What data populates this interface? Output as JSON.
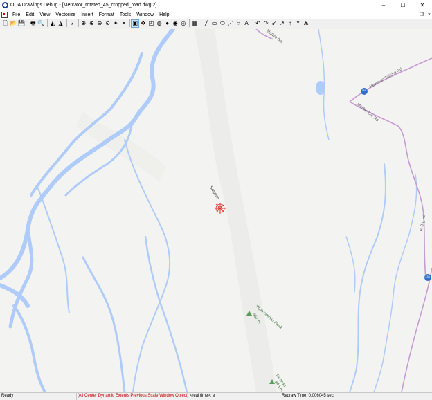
{
  "window": {
    "title": "ODA Drawings Debug - [Mercator_rotated_45_cropped_road.dwg:2]",
    "minimize": "–",
    "maximize": "☐",
    "close": "✕"
  },
  "mdi": {
    "minimize": "_",
    "restore": "❐",
    "close": "×"
  },
  "menu": [
    "File",
    "Edit",
    "View",
    "Vectorize",
    "Insert",
    "Format",
    "Tools",
    "Window",
    "Help"
  ],
  "toolbar": [
    {
      "name": "new-icon",
      "glyph": "🗋"
    },
    {
      "name": "open-icon",
      "glyph": "📂"
    },
    {
      "name": "save-icon",
      "glyph": "💾"
    },
    {
      "sep": true
    },
    {
      "name": "print-icon",
      "glyph": "🖶"
    },
    {
      "name": "print-preview-icon",
      "glyph": "🔍"
    },
    {
      "sep": true
    },
    {
      "name": "undo-draw-icon",
      "glyph": "◭"
    },
    {
      "name": "redo-draw-icon",
      "glyph": "◮"
    },
    {
      "sep": true
    },
    {
      "name": "help-icon",
      "glyph": "?"
    },
    {
      "sep": true
    },
    {
      "name": "zoom-window-icon",
      "glyph": "⊕"
    },
    {
      "name": "zoom-in-icon",
      "glyph": "⊕"
    },
    {
      "name": "zoom-out-icon",
      "glyph": "⊖"
    },
    {
      "name": "zoom-extents-icon",
      "glyph": "⊙"
    },
    {
      "name": "zoom-realtime-icon",
      "glyph": "✦"
    },
    {
      "name": "orbit-icon",
      "glyph": "◓"
    },
    {
      "sep": true
    },
    {
      "name": "select-icon",
      "glyph": "▣",
      "active": true
    },
    {
      "name": "pan-icon",
      "glyph": "✥"
    },
    {
      "name": "view-cube-icon",
      "glyph": "◰"
    },
    {
      "name": "render-wire-icon",
      "glyph": "◍"
    },
    {
      "name": "render-shade-icon",
      "glyph": "●"
    },
    {
      "name": "render-gouraud-icon",
      "glyph": "◉"
    },
    {
      "name": "render-hidden-icon",
      "glyph": "◎"
    },
    {
      "sep": true
    },
    {
      "name": "layers-icon",
      "glyph": "▦"
    },
    {
      "sep": true
    },
    {
      "name": "line-icon",
      "glyph": "╱"
    },
    {
      "name": "rectangle-icon",
      "glyph": "▭"
    },
    {
      "name": "ellipse-icon",
      "glyph": "⬭"
    },
    {
      "name": "point-icon",
      "glyph": "⋰"
    },
    {
      "name": "circle-icon",
      "glyph": "○"
    },
    {
      "name": "text-icon",
      "glyph": "A"
    },
    {
      "sep": true
    },
    {
      "name": "undo-icon",
      "glyph": "↶"
    },
    {
      "name": "redo-icon",
      "glyph": "↷"
    },
    {
      "name": "arrow-sw-icon",
      "glyph": "↙"
    },
    {
      "name": "arrow-ne-icon",
      "glyph": "↗"
    },
    {
      "name": "arrow-up-icon",
      "glyph": "↑"
    },
    {
      "name": "branch-icon",
      "glyph": "Y"
    },
    {
      "name": "tree-icon",
      "glyph": "Ѫ"
    }
  ],
  "map": {
    "labels": [
      {
        "id": "place-label",
        "text": "Salgosh"
      },
      {
        "id": "peak-label-1",
        "text": "Wyennmona Peak"
      },
      {
        "id": "peak-elev-1",
        "text": "967 m"
      },
      {
        "id": "peak-label-2",
        "text": "Nonnao"
      },
      {
        "id": "peak-elev-2",
        "text": "843 m"
      },
      {
        "id": "road-label-1",
        "text": "Newman Talisha Rd"
      },
      {
        "id": "road-label-2",
        "text": "Marble Bar Rd"
      },
      {
        "id": "road-label-3",
        "text": "Pl 3rg Rd"
      },
      {
        "id": "road-label-4",
        "text": "Marble Bar"
      },
      {
        "id": "shield-1",
        "text": "138"
      },
      {
        "id": "shield-2",
        "text": "138"
      }
    ],
    "colors": {
      "water": "#aecbfa",
      "road": "#c89ad4",
      "terrain": "#f3f3f1",
      "marker": "#e0221b",
      "peak": "#5a9a5a"
    }
  },
  "status": {
    "ready": "Ready",
    "options": [
      "All",
      "Center",
      "Dynamic",
      "Extents",
      "Previous",
      "Scale",
      "Window",
      "Object"
    ],
    "realtime": "<real time>:",
    "prompt": "e",
    "redraw": "Redraw Time: 0.006045 sec."
  }
}
